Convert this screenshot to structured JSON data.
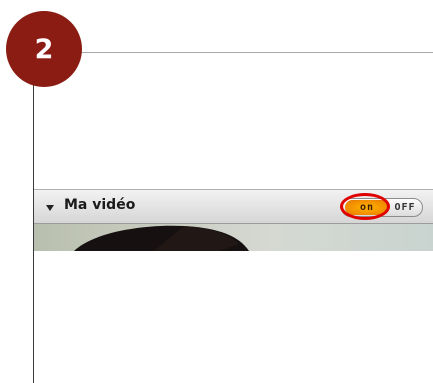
{
  "step": {
    "number": "2"
  },
  "panel": {
    "title": "Ma vidéo",
    "toggle": {
      "on_label": "on",
      "off_label": "OFF",
      "state": "on"
    }
  },
  "colors": {
    "step_badge": "#8b1c14",
    "toggle_on": "#f59a00",
    "highlight": "#e00000"
  },
  "icons": {
    "collapse": "triangle-down-icon"
  }
}
